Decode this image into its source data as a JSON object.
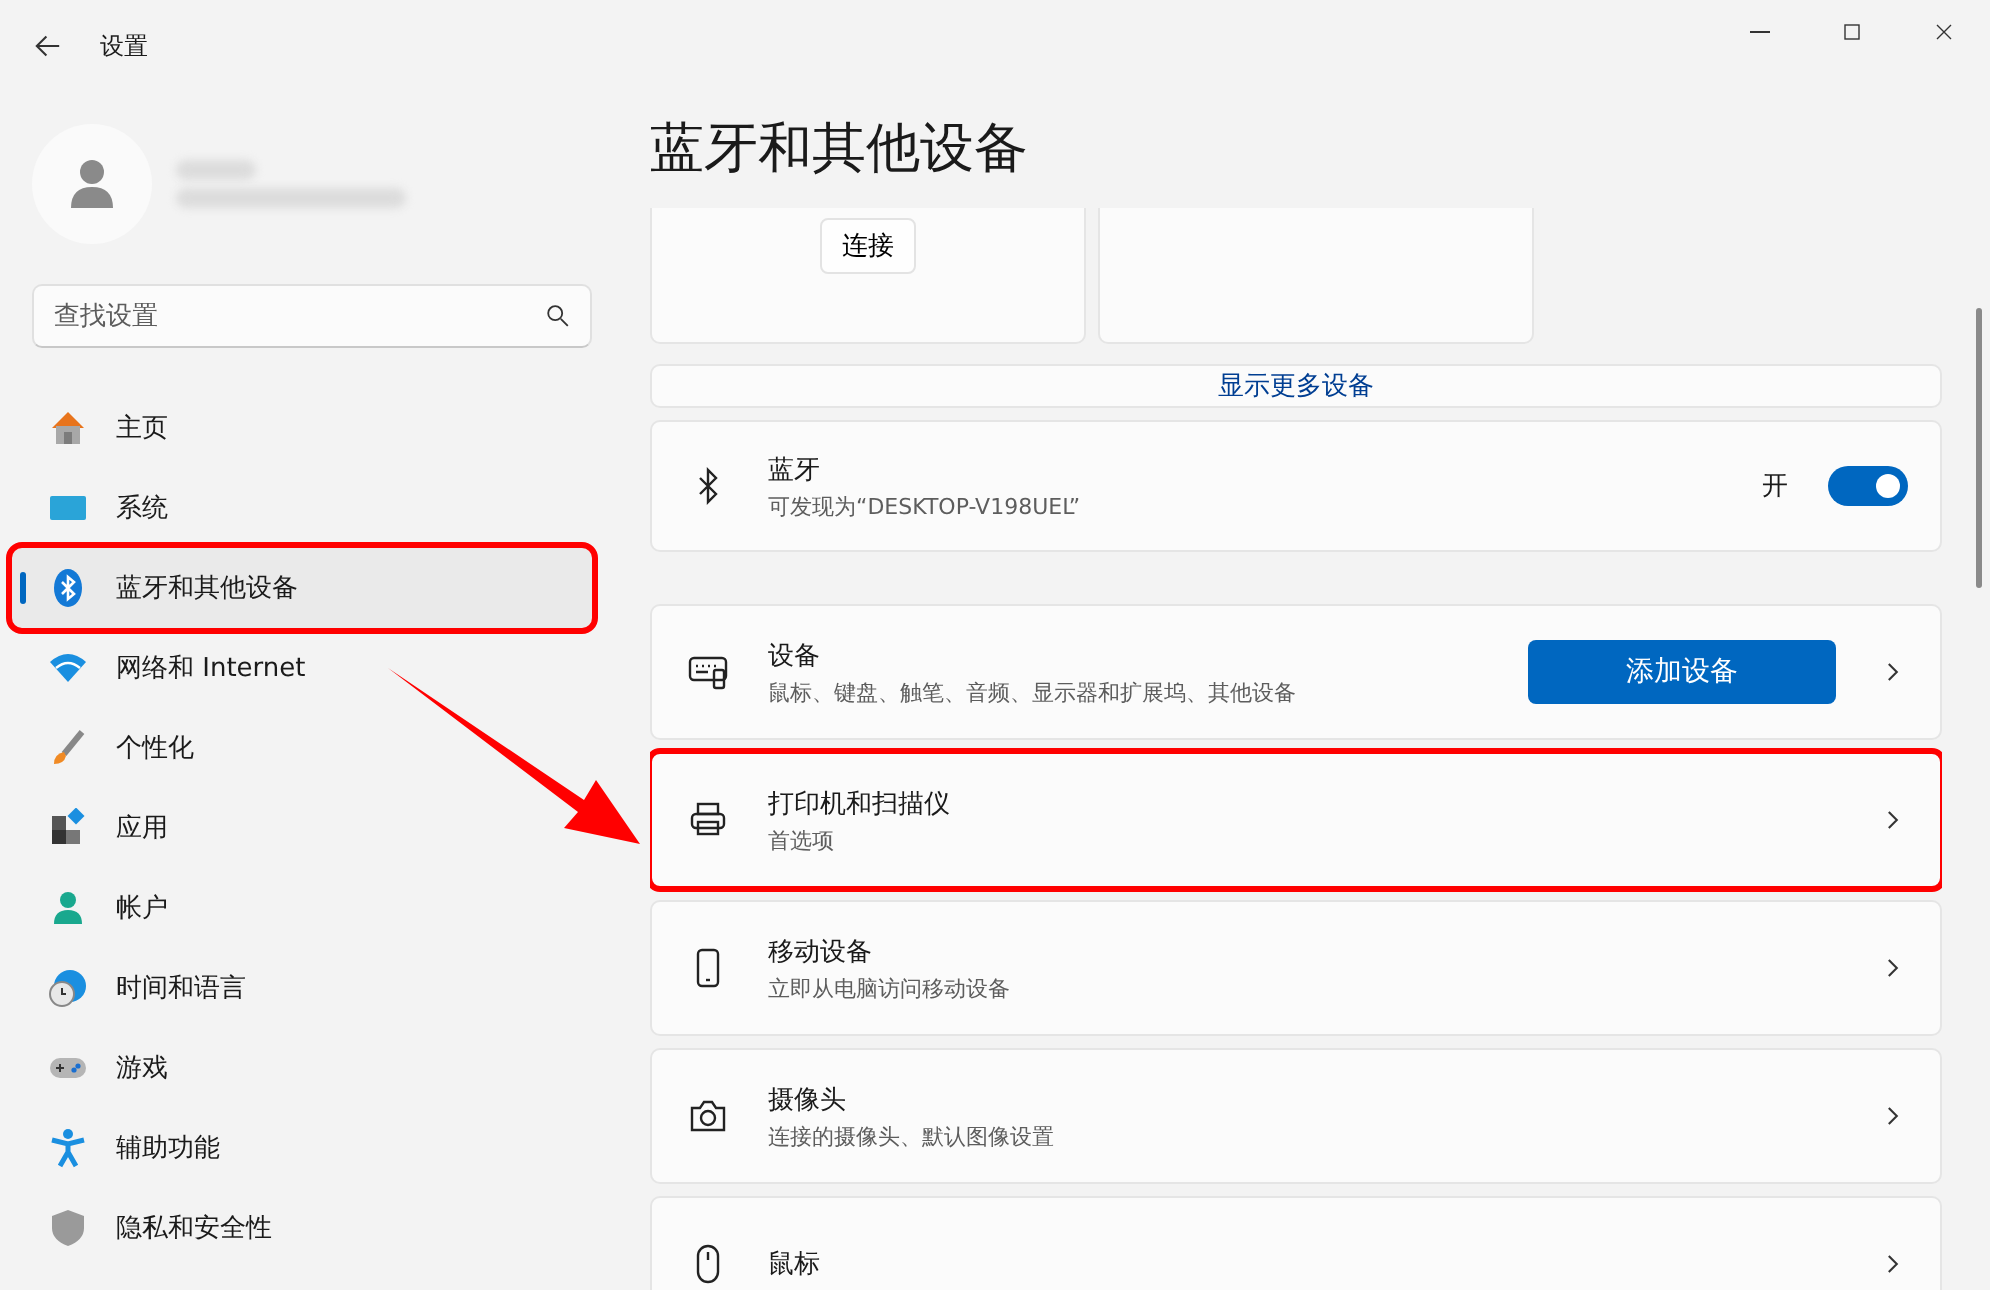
{
  "window": {
    "title": "设置"
  },
  "search": {
    "placeholder": "查找设置"
  },
  "nav": [
    {
      "kind": "home",
      "label": "主页",
      "selected": false,
      "outlined": false
    },
    {
      "kind": "system",
      "label": "系统",
      "selected": false,
      "outlined": false
    },
    {
      "kind": "bluetooth",
      "label": "蓝牙和其他设备",
      "selected": true,
      "outlined": true
    },
    {
      "kind": "network",
      "label": "网络和 Internet",
      "selected": false,
      "outlined": false
    },
    {
      "kind": "brush",
      "label": "个性化",
      "selected": false,
      "outlined": false
    },
    {
      "kind": "apps",
      "label": "应用",
      "selected": false,
      "outlined": false
    },
    {
      "kind": "account",
      "label": "帐户",
      "selected": false,
      "outlined": false
    },
    {
      "kind": "time",
      "label": "时间和语言",
      "selected": false,
      "outlined": false
    },
    {
      "kind": "gaming",
      "label": "游戏",
      "selected": false,
      "outlined": false
    },
    {
      "kind": "accessibility",
      "label": "辅助功能",
      "selected": false,
      "outlined": false
    },
    {
      "kind": "privacy",
      "label": "隐私和安全性",
      "selected": false,
      "outlined": false
    }
  ],
  "page_title": "蓝牙和其他设备",
  "device_tiles": [
    {
      "kind": "connect",
      "button": "连接"
    },
    {
      "kind": "blank"
    }
  ],
  "show_more": "显示更多设备",
  "bluetooth": {
    "title": "蓝牙",
    "subtitle": "可发现为“DESKTOP-V198UEL”",
    "state_label": "开",
    "on": true
  },
  "rows": [
    {
      "kind": "devices",
      "title": "设备",
      "subtitle": "鼠标、键盘、触笔、音频、显示器和扩展坞、其他设备",
      "button": "添加设备",
      "outlined": false
    },
    {
      "kind": "printer",
      "title": "打印机和扫描仪",
      "subtitle": "首选项",
      "outlined": true
    },
    {
      "kind": "phone",
      "title": "移动设备",
      "subtitle": "立即从电脑访问移动设备",
      "outlined": false
    },
    {
      "kind": "camera",
      "title": "摄像头",
      "subtitle": "连接的摄像头、默认图像设置",
      "outlined": false
    },
    {
      "kind": "mouse",
      "title": "鼠标",
      "outlined": false
    }
  ]
}
